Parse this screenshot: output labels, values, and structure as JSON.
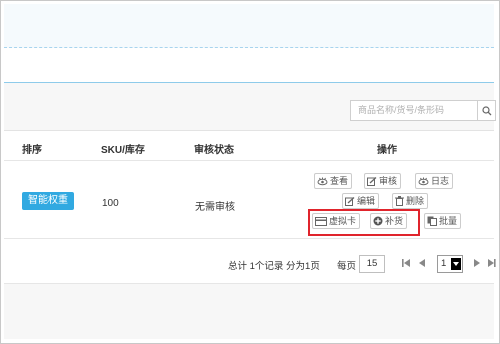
{
  "search": {
    "placeholder": "商品名称/货号/条形码"
  },
  "table": {
    "headers": [
      "排序",
      "SKU/库存",
      "审核状态",
      "操作"
    ],
    "row": {
      "sort_tag": "智能权重",
      "sku_stock": "100",
      "review_status": "无需审核",
      "actions": {
        "view": "查看",
        "review": "审核",
        "log": "日志",
        "edit": "编辑",
        "delete": "删除",
        "virtual_card": "虚拟卡",
        "restock": "补货",
        "batch": "批量"
      }
    }
  },
  "pager": {
    "summary": "总计 1个记录 分为1页",
    "per_page_label": "每页",
    "per_page_value": "15",
    "current_page": "1"
  },
  "colors": {
    "accent": "#31a9e1",
    "highlight": "#e0242c"
  }
}
